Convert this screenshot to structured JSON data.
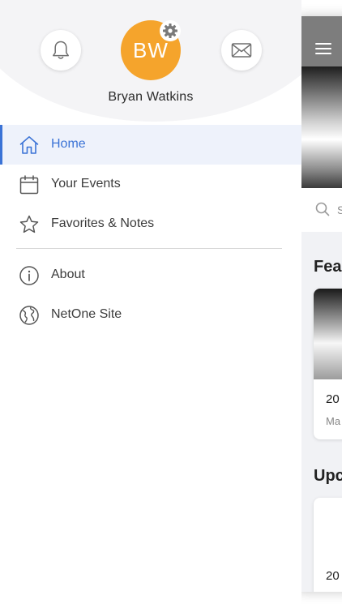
{
  "profile": {
    "initials": "BW",
    "name": "Bryan Watkins",
    "avatar_color": "#f5a42c"
  },
  "header_icons": {
    "notifications": "bell-icon",
    "messages": "envelope-icon",
    "settings": "gear-icon"
  },
  "menu": {
    "primary": [
      {
        "label": "Home",
        "icon": "home-icon",
        "active": true
      },
      {
        "label": "Your Events",
        "icon": "calendar-icon",
        "active": false
      },
      {
        "label": "Favorites & Notes",
        "icon": "star-icon",
        "active": false
      }
    ],
    "secondary": [
      {
        "label": "About",
        "icon": "info-icon"
      },
      {
        "label": "NetOne Site",
        "icon": "globe-icon"
      }
    ]
  },
  "main": {
    "search_placeholder_fragment": "S",
    "section_featured": "Fea",
    "featured_card_year": "20",
    "featured_card_sub": "Ma",
    "section_upcoming": "Upc",
    "upcoming_card_year": "20"
  },
  "colors": {
    "accent": "#3b73d6",
    "active_bg": "#eef2fb",
    "header_bar": "#7d7d7d"
  }
}
